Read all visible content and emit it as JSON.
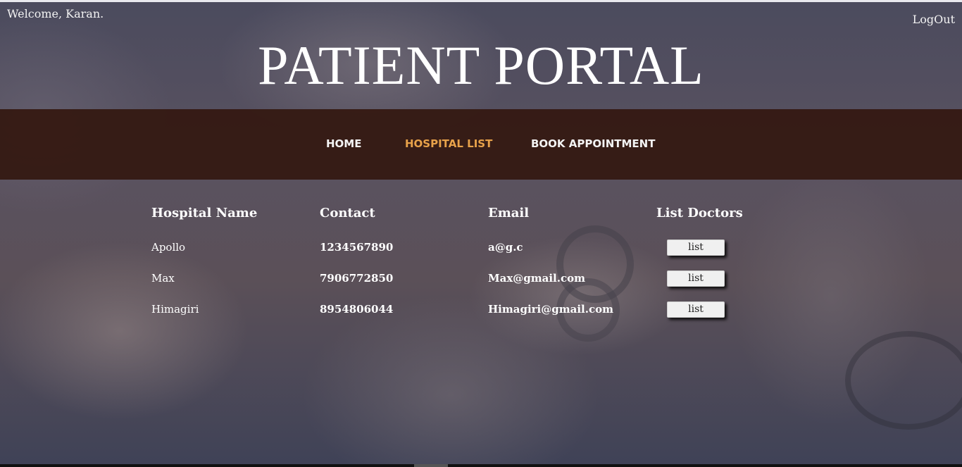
{
  "header": {
    "welcome": "Welcome, Karan.",
    "logout": "LogOut",
    "title": "PATIENT PORTAL"
  },
  "nav": {
    "items": [
      {
        "label": "HOME",
        "active": false
      },
      {
        "label": "HOSPITAL LIST",
        "active": true
      },
      {
        "label": "BOOK APPOINTMENT",
        "active": false
      }
    ],
    "active_color": "#e8a24a",
    "bar_color": "#341810"
  },
  "table": {
    "headers": [
      "Hospital Name",
      "Contact",
      "Email",
      "List Doctors"
    ],
    "rows": [
      {
        "name": "Apollo",
        "contact": "1234567890",
        "email": "a@g.c",
        "action": "list"
      },
      {
        "name": "Max",
        "contact": "7906772850",
        "email": "Max@gmail.com",
        "action": "list"
      },
      {
        "name": "Himagiri",
        "contact": "8954806044",
        "email": "Himagiri@gmail.com",
        "action": "list"
      }
    ]
  }
}
